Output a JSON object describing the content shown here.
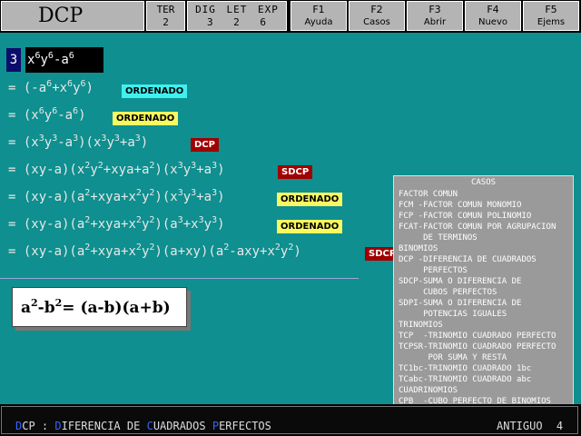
{
  "header": {
    "title": "DCP",
    "ter_label": "TER",
    "ter_value": "2",
    "dle_labels": "DIG LET EXP",
    "dle_values": "3 2 6",
    "fkeys": [
      {
        "key": "F1",
        "label": "Ayuda"
      },
      {
        "key": "F2",
        "label": "Casos"
      },
      {
        "key": "F3",
        "label": "Abrir"
      },
      {
        "key": "F4",
        "label": "Nuevo"
      },
      {
        "key": "F5",
        "label": "Ejems"
      }
    ]
  },
  "problem": {
    "number": "3",
    "expression": "x6y6-a6"
  },
  "steps": [
    {
      "text": "= (-a6+x6y6)",
      "badge": "ORDENADO"
    },
    {
      "text": "= (x6y6-a6)",
      "badge": "ORDENADO"
    },
    {
      "text": "= (x3y3-a3)(x3y3+a3)",
      "badge": "DCP"
    },
    {
      "text": "= (xy-a)(x2y2+xya+a2)(x3y3+a3)",
      "badge": "SDCP"
    },
    {
      "text": "= (xy-a)(a2+xya+x2y2)(x3y3+a3)",
      "badge": "ORDENADO"
    },
    {
      "text": "= (xy-a)(a2+xya+x2y2)(a3+x3y3)",
      "badge": "ORDENADO"
    },
    {
      "text": "= (xy-a)(a2+xya+x2y2)(a+xy)(a2-axy+x2y2)",
      "badge": "SDCP"
    }
  ],
  "formula": "a2-b2= (a-b)(a+b)",
  "casos": {
    "title": "CASOS",
    "rows": [
      "FACTOR COMUN",
      "FCM -FACTOR COMUN MONOMIO",
      "FCP -FACTOR COMUN POLINOMIO",
      "FCAT-FACTOR COMUN POR AGRUPACION",
      "     DE TERMINOS",
      "BINOMIOS",
      "DCP -DIFERENCIA DE CUADRADOS",
      "     PERFECTOS",
      "SDCP-SUMA O DIFERENCIA DE",
      "     CUBOS PERFECTOS",
      "SDPI-SUMA O DIFERENCIA DE",
      "     POTENCIAS IGUALES",
      "TRINOMIOS",
      "TCP  -TRINOMIO CUADRADO PERFECTO",
      "TCPSR-TRINOMIO CUADRADO PERFECTO",
      "      POR SUMA Y RESTA",
      "TC1bc-TRINOMIO CUADRADO 1bc",
      "TCabc-TRINOMIO CUADRADO abc",
      "CUADRINOMIOS",
      "CPB  -CUBO PERFECTO DE BINOMIOS"
    ]
  },
  "status": {
    "text": "DCP : DIFERENCIA DE CUADRADOS PERFECTOS",
    "right_label": "ANTIGUO",
    "right_value": "4"
  },
  "colors": {
    "background": "#0f8f8f",
    "badge_ordenado_cyan": "#3ff0f0",
    "badge_ordenado_yellow": "#f8f860",
    "badge_red": "#a00000"
  }
}
